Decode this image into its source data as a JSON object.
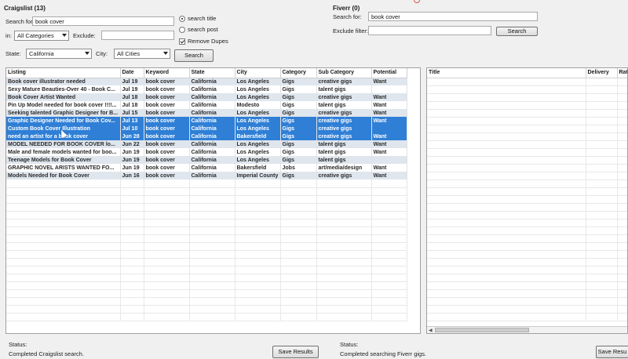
{
  "craigslist": {
    "title": "Craigslist (13)",
    "search_for_label": "Search for:",
    "search_for_value": "book cover",
    "in_label": "in:",
    "category_value": "All Categories",
    "exclude_label": "Exclude:",
    "exclude_value": "",
    "search_title_label": "search title",
    "search_post_label": "search post",
    "remove_dupes_label": "Remove Dupes",
    "state_label": "State:",
    "state_value": "California",
    "city_label": "City:",
    "city_value": "All Cities",
    "search_button": "Search",
    "columns": [
      "Listing",
      "Date",
      "Keyword",
      "State",
      "City",
      "Category",
      "Sub Category",
      "Potential"
    ],
    "rows": [
      {
        "listing": "Book cover illustrator needed",
        "date": "Jul 19",
        "keyword": "book cover",
        "state": "California",
        "city": "Los Angeles",
        "category": "Gigs",
        "subcategory": "creative gigs",
        "potential": "Want"
      },
      {
        "listing": "Sexy Mature Beauties-Over 40 - Book C...",
        "date": "Jul 19",
        "keyword": "book cover",
        "state": "California",
        "city": "Los Angeles",
        "category": "Gigs",
        "subcategory": "talent gigs",
        "potential": ""
      },
      {
        "listing": "Book Cover Artist Wanted",
        "date": "Jul 18",
        "keyword": "book cover",
        "state": "California",
        "city": "Los Angeles",
        "category": "Gigs",
        "subcategory": "creative gigs",
        "potential": "Want"
      },
      {
        "listing": "Pin Up Model needed for book cover !!!!...",
        "date": "Jul 18",
        "keyword": "book cover",
        "state": "California",
        "city": "Modesto",
        "category": "Gigs",
        "subcategory": "talent gigs",
        "potential": "Want"
      },
      {
        "listing": "Seeking talented Graphic Designer for B...",
        "date": "Jul 15",
        "keyword": "book cover",
        "state": "California",
        "city": "Los Angeles",
        "category": "Gigs",
        "subcategory": "creative gigs",
        "potential": "Want"
      },
      {
        "listing": "Graphic Designer Needed for Book Cov...",
        "date": "Jul 13",
        "keyword": "book cover",
        "state": "California",
        "city": "Los Angeles",
        "category": "Gigs",
        "subcategory": "creative gigs",
        "potential": "Want"
      },
      {
        "listing": "Custom Book Cover Illustration",
        "date": "Jul 10",
        "keyword": "book cover",
        "state": "California",
        "city": "Los Angeles",
        "category": "Gigs",
        "subcategory": "creative gigs",
        "potential": ""
      },
      {
        "listing": "need an artist for a book cover",
        "date": "Jun 28",
        "keyword": "book cover",
        "state": "California",
        "city": "Bakersfield",
        "category": "Gigs",
        "subcategory": "creative gigs",
        "potential": "Want"
      },
      {
        "listing": "MODEL NEEDED FOR BOOK COVER lo...",
        "date": "Jun 22",
        "keyword": "book cover",
        "state": "California",
        "city": "Los Angeles",
        "category": "Gigs",
        "subcategory": "talent gigs",
        "potential": "Want"
      },
      {
        "listing": "Male and female models wanted for boo...",
        "date": "Jun 19",
        "keyword": "book cover",
        "state": "California",
        "city": "Los Angeles",
        "category": "Gigs",
        "subcategory": "talent gigs",
        "potential": "Want"
      },
      {
        "listing": "Teenage Models for Book Cover",
        "date": "Jun 19",
        "keyword": "book cover",
        "state": "California",
        "city": "Los Angeles",
        "category": "Gigs",
        "subcategory": "talent gigs",
        "potential": ""
      },
      {
        "listing": "GRAPHIC NOVEL ARISTS WANTED FO...",
        "date": "Jun 19",
        "keyword": "book cover",
        "state": "California",
        "city": "Bakersfield",
        "category": "Jobs",
        "subcategory": "art/media/design",
        "potential": "Want"
      },
      {
        "listing": "Models Needed for Book Cover",
        "date": "Jun 16",
        "keyword": "book cover",
        "state": "California",
        "city": "Imperial County",
        "category": "Gigs",
        "subcategory": "creative gigs",
        "potential": "Want"
      }
    ],
    "status_label": "Status:",
    "status_text": "Completed Craigslist search.",
    "save_button": "Save Results"
  },
  "fiverr": {
    "title": "Fiverr (0)",
    "search_for_label": "Search for:",
    "search_for_value": "book cover",
    "exclude_label": "Exclude filter:",
    "exclude_value": "",
    "search_button": "Search",
    "columns": [
      "Title",
      "Delivery",
      "Ratin"
    ],
    "status_label": "Status:",
    "status_text": "Completed searching Fiverr gigs.",
    "save_button": "Save Resu"
  },
  "colors": {
    "selected_row": "#2f7fd6",
    "alt_row": "#dfe6ee",
    "window_bg": "#f0f0f0"
  }
}
